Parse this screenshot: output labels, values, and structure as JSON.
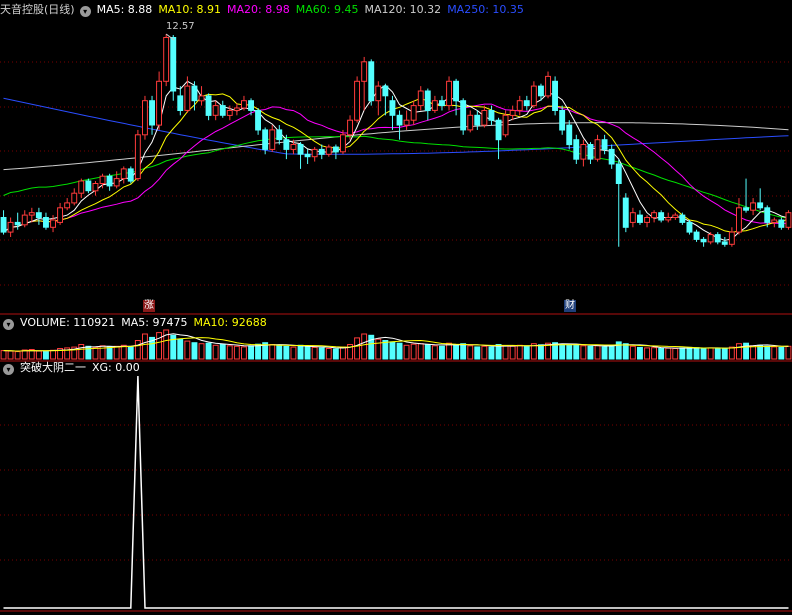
{
  "price_panel": {
    "title": "天音控股(日线)",
    "indicators": [
      {
        "label": "MA5: 8.88",
        "color": "#ffffff"
      },
      {
        "label": "MA10: 8.91",
        "color": "#ffff00"
      },
      {
        "label": "MA20: 8.98",
        "color": "#ff00ff"
      },
      {
        "label": "MA60: 9.45",
        "color": "#00e000"
      },
      {
        "label": "MA120: 10.32",
        "color": "#cccccc"
      },
      {
        "label": "MA250: 10.35",
        "color": "#2a4dff"
      }
    ],
    "peak_label": "12.57",
    "event_markers": [
      {
        "text": "涨",
        "bg": "#8b1a1a",
        "color": "#ffffff"
      },
      {
        "text": "财",
        "bg": "#1f3f7a",
        "color": "#ffffff"
      }
    ]
  },
  "volume_panel": {
    "indicators": [
      {
        "label": "VOLUME: 110921",
        "color": "#ffffff"
      },
      {
        "label": "MA5: 97475",
        "color": "#ffffff"
      },
      {
        "label": "MA10: 92688",
        "color": "#ffff00"
      }
    ]
  },
  "signal_panel": {
    "indicators": [
      {
        "label": "突破大阴二一",
        "color": "#ffffff"
      },
      {
        "label": "XG: 0.00",
        "color": "#ffffff"
      }
    ]
  },
  "colors": {
    "up": "#ff3b3b",
    "down": "#54ffff",
    "grid": "#7a0000",
    "divider": "#b01010",
    "signal": "#ffffff"
  },
  "chart_data": {
    "type": "candlestick",
    "price_ylim": [
      6.9,
      12.9
    ],
    "candles": [
      [
        8.8,
        8.5,
        8.95,
        8.45
      ],
      [
        8.5,
        8.7,
        8.8,
        8.4
      ],
      [
        8.7,
        8.65,
        8.9,
        8.55
      ],
      [
        8.65,
        8.85,
        8.95,
        8.6
      ],
      [
        8.85,
        8.9,
        9.0,
        8.7
      ],
      [
        8.9,
        8.8,
        9.0,
        8.65
      ],
      [
        8.8,
        8.6,
        8.9,
        8.55
      ],
      [
        8.6,
        8.75,
        8.85,
        8.5
      ],
      [
        8.7,
        9.0,
        9.1,
        8.65
      ],
      [
        9.0,
        9.1,
        9.2,
        8.95
      ],
      [
        9.1,
        9.3,
        9.4,
        9.05
      ],
      [
        9.3,
        9.55,
        9.6,
        9.2
      ],
      [
        9.55,
        9.35,
        9.6,
        9.3
      ],
      [
        9.35,
        9.5,
        9.55,
        9.25
      ],
      [
        9.5,
        9.65,
        9.7,
        9.4
      ],
      [
        9.65,
        9.45,
        9.7,
        9.35
      ],
      [
        9.45,
        9.6,
        9.75,
        9.4
      ],
      [
        9.6,
        9.8,
        9.85,
        9.5
      ],
      [
        9.8,
        9.55,
        9.85,
        9.5
      ],
      [
        9.6,
        10.5,
        10.6,
        9.55
      ],
      [
        10.5,
        11.2,
        11.3,
        10.4
      ],
      [
        11.2,
        10.7,
        11.3,
        10.5
      ],
      [
        10.7,
        11.6,
        11.8,
        10.6
      ],
      [
        11.6,
        12.5,
        12.57,
        11.5
      ],
      [
        12.5,
        11.4,
        12.55,
        11.2
      ],
      [
        11.3,
        11.0,
        11.5,
        10.9
      ],
      [
        11.0,
        11.5,
        11.7,
        10.95
      ],
      [
        11.5,
        11.2,
        11.6,
        11.0
      ],
      [
        11.2,
        11.3,
        11.5,
        11.1
      ],
      [
        11.3,
        10.9,
        11.35,
        10.8
      ],
      [
        10.9,
        11.1,
        11.2,
        10.8
      ],
      [
        11.1,
        10.9,
        11.2,
        10.85
      ],
      [
        10.9,
        11.0,
        11.1,
        10.8
      ],
      [
        11.0,
        11.05,
        11.15,
        10.9
      ],
      [
        11.05,
        11.2,
        11.3,
        11.0
      ],
      [
        11.2,
        11.0,
        11.25,
        10.9
      ],
      [
        11.0,
        10.6,
        11.05,
        10.5
      ],
      [
        10.6,
        10.2,
        10.65,
        10.1
      ],
      [
        10.2,
        10.6,
        10.7,
        10.15
      ],
      [
        10.6,
        10.4,
        10.7,
        10.3
      ],
      [
        10.4,
        10.2,
        10.5,
        10.0
      ],
      [
        10.2,
        10.3,
        10.4,
        10.1
      ],
      [
        10.3,
        10.1,
        10.35,
        9.8
      ],
      [
        10.1,
        10.05,
        10.2,
        9.9
      ],
      [
        10.05,
        10.2,
        10.25,
        9.95
      ],
      [
        10.2,
        10.1,
        10.3,
        10.0
      ],
      [
        10.1,
        10.25,
        10.3,
        10.05
      ],
      [
        10.25,
        10.15,
        10.3,
        10.0
      ],
      [
        10.15,
        10.5,
        10.6,
        10.1
      ],
      [
        10.5,
        10.8,
        10.9,
        10.4
      ],
      [
        10.8,
        11.6,
        11.7,
        10.75
      ],
      [
        11.6,
        12.0,
        12.1,
        11.0
      ],
      [
        12.0,
        11.2,
        12.05,
        11.1
      ],
      [
        11.2,
        11.5,
        11.6,
        10.9
      ],
      [
        11.5,
        11.3,
        11.55,
        10.9
      ],
      [
        11.2,
        10.9,
        11.3,
        10.6
      ],
      [
        10.9,
        10.7,
        11.0,
        10.4
      ],
      [
        10.7,
        10.8,
        11.0,
        10.6
      ],
      [
        10.8,
        11.1,
        11.2,
        10.7
      ],
      [
        11.1,
        11.4,
        11.5,
        11.0
      ],
      [
        11.4,
        11.0,
        11.45,
        10.8
      ],
      [
        11.0,
        11.2,
        11.3,
        10.95
      ],
      [
        11.2,
        11.1,
        11.3,
        11.0
      ],
      [
        11.1,
        11.6,
        11.7,
        11.0
      ],
      [
        11.6,
        11.2,
        11.65,
        10.9
      ],
      [
        11.2,
        10.6,
        11.25,
        10.5
      ],
      [
        10.6,
        10.9,
        11.0,
        10.55
      ],
      [
        10.9,
        10.7,
        11.0,
        10.6
      ],
      [
        10.7,
        11.0,
        11.1,
        10.65
      ],
      [
        11.0,
        10.8,
        11.1,
        10.7
      ],
      [
        10.8,
        10.4,
        10.85,
        10.0
      ],
      [
        10.5,
        10.9,
        11.0,
        10.45
      ],
      [
        10.9,
        11.0,
        11.1,
        10.8
      ],
      [
        11.0,
        11.2,
        11.3,
        10.9
      ],
      [
        11.2,
        11.1,
        11.3,
        11.0
      ],
      [
        11.1,
        11.5,
        11.6,
        11.05
      ],
      [
        11.5,
        11.3,
        11.55,
        11.2
      ],
      [
        11.3,
        11.7,
        11.8,
        11.25
      ],
      [
        11.6,
        11.0,
        11.7,
        10.9
      ],
      [
        11.0,
        10.6,
        11.1,
        10.5
      ],
      [
        10.7,
        10.3,
        10.8,
        10.2
      ],
      [
        10.4,
        10.0,
        10.5,
        9.9
      ],
      [
        10.0,
        10.3,
        10.4,
        9.85
      ],
      [
        10.3,
        10.0,
        10.35,
        9.9
      ],
      [
        10.0,
        10.4,
        10.5,
        9.95
      ],
      [
        10.4,
        10.2,
        10.5,
        10.1
      ],
      [
        10.2,
        9.9,
        10.3,
        9.8
      ],
      [
        9.9,
        9.5,
        10.0,
        8.2
      ],
      [
        9.2,
        8.6,
        9.3,
        8.5
      ],
      [
        8.7,
        8.9,
        9.0,
        8.6
      ],
      [
        8.85,
        8.7,
        8.95,
        8.65
      ],
      [
        8.7,
        8.8,
        8.85,
        8.6
      ],
      [
        8.8,
        8.9,
        8.95,
        8.7
      ],
      [
        8.9,
        8.75,
        8.95,
        8.7
      ],
      [
        8.75,
        8.8,
        8.9,
        8.7
      ],
      [
        8.8,
        8.85,
        8.9,
        8.75
      ],
      [
        8.85,
        8.7,
        8.9,
        8.65
      ],
      [
        8.7,
        8.5,
        8.75,
        8.45
      ],
      [
        8.5,
        8.35,
        8.55,
        8.3
      ],
      [
        8.35,
        8.3,
        8.4,
        8.2
      ],
      [
        8.3,
        8.45,
        8.5,
        8.25
      ],
      [
        8.45,
        8.3,
        8.5,
        8.25
      ],
      [
        8.3,
        8.25,
        8.4,
        8.2
      ],
      [
        8.25,
        8.5,
        8.6,
        8.2
      ],
      [
        8.5,
        9.0,
        9.2,
        8.45
      ],
      [
        9.0,
        8.95,
        9.6,
        8.9
      ],
      [
        8.95,
        9.1,
        9.2,
        8.85
      ],
      [
        9.1,
        9.0,
        9.4,
        8.95
      ],
      [
        9.0,
        8.7,
        9.05,
        8.6
      ],
      [
        8.7,
        8.75,
        8.8,
        8.6
      ],
      [
        8.75,
        8.6,
        8.8,
        8.55
      ],
      [
        8.6,
        8.9,
        8.95,
        8.55
      ]
    ],
    "volume": [
      [
        32,
        1
      ],
      [
        30,
        1
      ],
      [
        28,
        1
      ],
      [
        34,
        1
      ],
      [
        36,
        1
      ],
      [
        30,
        1
      ],
      [
        28,
        -1
      ],
      [
        33,
        1
      ],
      [
        40,
        1
      ],
      [
        42,
        1
      ],
      [
        45,
        1
      ],
      [
        55,
        1
      ],
      [
        48,
        -1
      ],
      [
        44,
        1
      ],
      [
        50,
        1
      ],
      [
        46,
        -1
      ],
      [
        48,
        1
      ],
      [
        52,
        1
      ],
      [
        47,
        -1
      ],
      [
        70,
        1
      ],
      [
        95,
        1
      ],
      [
        82,
        -1
      ],
      [
        100,
        1
      ],
      [
        110,
        1
      ],
      [
        90,
        -1
      ],
      [
        75,
        -1
      ],
      [
        68,
        1
      ],
      [
        62,
        -1
      ],
      [
        58,
        1
      ],
      [
        60,
        -1
      ],
      [
        52,
        1
      ],
      [
        55,
        -1
      ],
      [
        50,
        1
      ],
      [
        48,
        1
      ],
      [
        46,
        1
      ],
      [
        50,
        -1
      ],
      [
        56,
        -1
      ],
      [
        62,
        -1
      ],
      [
        55,
        1
      ],
      [
        50,
        -1
      ],
      [
        48,
        -1
      ],
      [
        45,
        1
      ],
      [
        52,
        -1
      ],
      [
        47,
        -1
      ],
      [
        44,
        1
      ],
      [
        42,
        -1
      ],
      [
        40,
        1
      ],
      [
        38,
        -1
      ],
      [
        45,
        1
      ],
      [
        55,
        1
      ],
      [
        80,
        1
      ],
      [
        95,
        1
      ],
      [
        90,
        -1
      ],
      [
        75,
        1
      ],
      [
        70,
        -1
      ],
      [
        65,
        -1
      ],
      [
        60,
        -1
      ],
      [
        52,
        1
      ],
      [
        56,
        1
      ],
      [
        58,
        1
      ],
      [
        55,
        -1
      ],
      [
        50,
        1
      ],
      [
        48,
        -1
      ],
      [
        60,
        1
      ],
      [
        55,
        -1
      ],
      [
        58,
        -1
      ],
      [
        50,
        1
      ],
      [
        46,
        -1
      ],
      [
        48,
        1
      ],
      [
        45,
        -1
      ],
      [
        55,
        -1
      ],
      [
        50,
        1
      ],
      [
        48,
        1
      ],
      [
        52,
        1
      ],
      [
        47,
        -1
      ],
      [
        58,
        1
      ],
      [
        54,
        -1
      ],
      [
        60,
        1
      ],
      [
        62,
        -1
      ],
      [
        56,
        -1
      ],
      [
        54,
        -1
      ],
      [
        52,
        -1
      ],
      [
        50,
        1
      ],
      [
        48,
        -1
      ],
      [
        50,
        1
      ],
      [
        46,
        -1
      ],
      [
        52,
        -1
      ],
      [
        65,
        -1
      ],
      [
        58,
        -1
      ],
      [
        48,
        1
      ],
      [
        44,
        -1
      ],
      [
        42,
        1
      ],
      [
        43,
        1
      ],
      [
        40,
        -1
      ],
      [
        41,
        1
      ],
      [
        40,
        1
      ],
      [
        42,
        -1
      ],
      [
        44,
        -1
      ],
      [
        43,
        -1
      ],
      [
        40,
        -1
      ],
      [
        42,
        1
      ],
      [
        41,
        -1
      ],
      [
        40,
        -1
      ],
      [
        45,
        1
      ],
      [
        58,
        1
      ],
      [
        60,
        -1
      ],
      [
        50,
        1
      ],
      [
        52,
        -1
      ],
      [
        48,
        -1
      ],
      [
        46,
        1
      ],
      [
        44,
        -1
      ],
      [
        48,
        1
      ]
    ],
    "signal": [
      0,
      0,
      0,
      0,
      0,
      0,
      0,
      0,
      0,
      0,
      0,
      0,
      0,
      0,
      0,
      0,
      0,
      0,
      0,
      1,
      0,
      0,
      0,
      0,
      0,
      0,
      0,
      0,
      0,
      0,
      0,
      0,
      0,
      0,
      0,
      0,
      0,
      0,
      0,
      0,
      0,
      0,
      0,
      0,
      0,
      0,
      0,
      0,
      0,
      0,
      0,
      0,
      0,
      0,
      0,
      0,
      0,
      0,
      0,
      0,
      0,
      0,
      0,
      0,
      0,
      0,
      0,
      0,
      0,
      0,
      0,
      0,
      0,
      0,
      0,
      0,
      0,
      0,
      0,
      0,
      0,
      0,
      0,
      0,
      0,
      0,
      0,
      0,
      0,
      0,
      0,
      0,
      0,
      0,
      0,
      0,
      0,
      0,
      0,
      0,
      0,
      0,
      0,
      0,
      0,
      0,
      0,
      0,
      0,
      0,
      0,
      0
    ]
  }
}
